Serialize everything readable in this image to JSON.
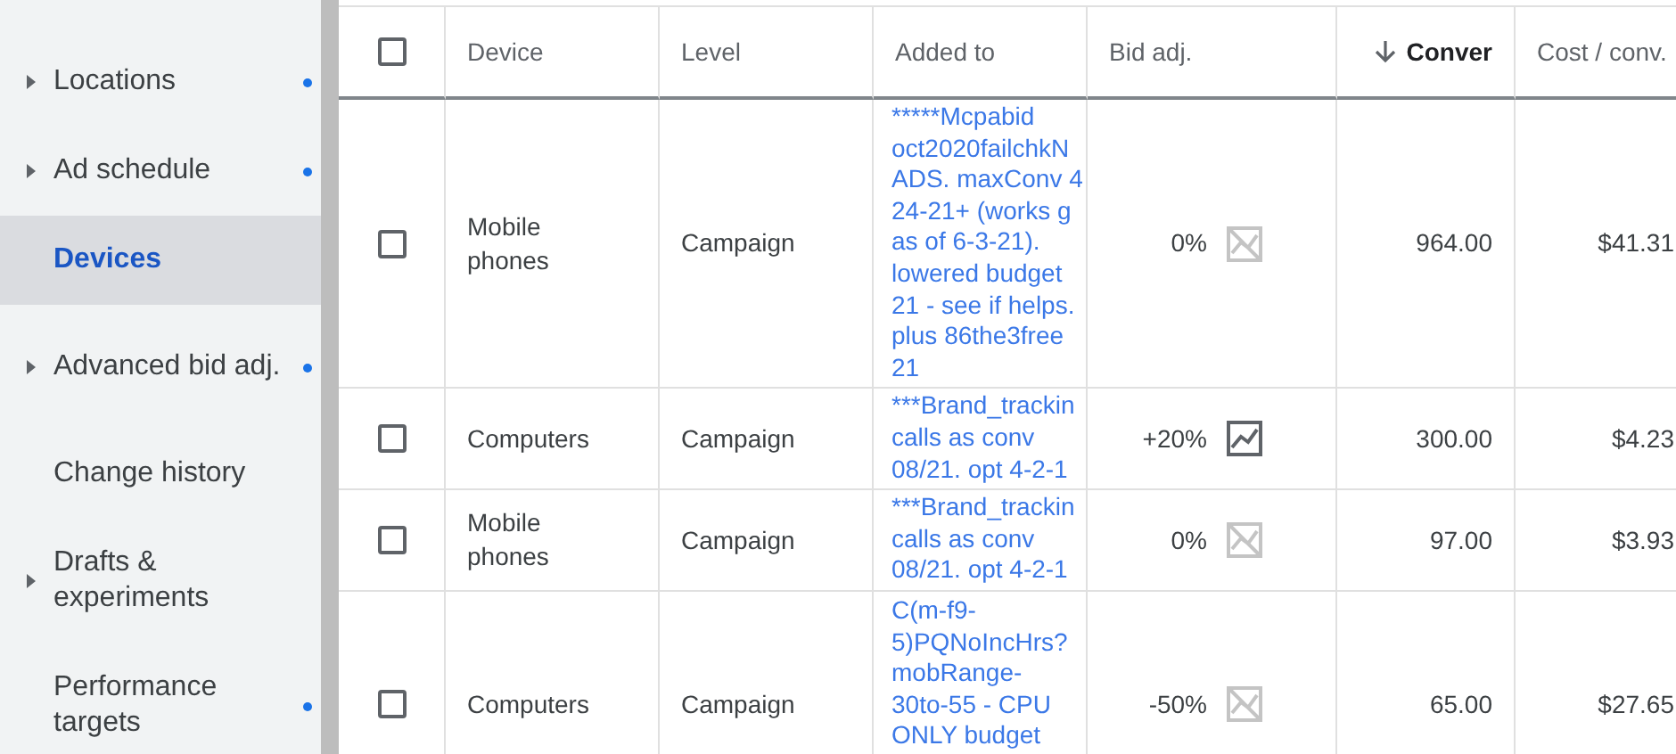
{
  "sidebar": {
    "items": [
      {
        "label": "Locations",
        "expandable": true,
        "dot": true,
        "selected": false
      },
      {
        "label": "Ad schedule",
        "expandable": true,
        "dot": true,
        "selected": false
      },
      {
        "label": "Devices",
        "expandable": false,
        "dot": false,
        "selected": true
      },
      {
        "label": "Advanced bid adj.",
        "expandable": true,
        "dot": true,
        "selected": false
      },
      {
        "label": "Change history",
        "expandable": false,
        "dot": false,
        "selected": false
      },
      {
        "label": "Drafts & experiments",
        "expandable": true,
        "dot": false,
        "selected": false
      },
      {
        "label": "Performance targets",
        "expandable": false,
        "dot": true,
        "selected": false
      }
    ]
  },
  "table": {
    "select_all": {
      "checked": false
    },
    "columns": [
      {
        "label": "Device",
        "sorted": false
      },
      {
        "label": "Level",
        "sorted": false
      },
      {
        "label": "Added to",
        "sorted": false
      },
      {
        "label": "Bid adj.",
        "sorted": false
      },
      {
        "label": "Conver",
        "sorted": true
      },
      {
        "label": "Cost / conv.",
        "sorted": false
      }
    ],
    "rows": [
      {
        "checked": false,
        "device": "Mobile phones",
        "level": "Campaign",
        "added_to": "*****Mcpabid\noct2020failchkN\nADS. maxConv 4\n24-21+ (works g\nas of 6-3-21).\nlowered budget\n21 - see if helps.\nplus 86the3free\n21",
        "bid_adj": "0%",
        "chart_enabled": false,
        "conversions": "964.00",
        "cost_per_conv": "$41.31"
      },
      {
        "checked": false,
        "device": "Computers",
        "level": "Campaign",
        "added_to": "***Brand_trackin\ncalls as conv\n08/21. opt 4-2-1",
        "bid_adj": "+20%",
        "chart_enabled": true,
        "conversions": "300.00",
        "cost_per_conv": "$4.23"
      },
      {
        "checked": false,
        "device": "Mobile phones",
        "level": "Campaign",
        "added_to": "***Brand_trackin\ncalls as conv\n08/21. opt 4-2-1",
        "bid_adj": "0%",
        "chart_enabled": false,
        "conversions": "97.00",
        "cost_per_conv": "$3.93"
      },
      {
        "checked": false,
        "device": "Computers",
        "level": "Campaign",
        "added_to": "C(m-f9-\n5)PQNoIncHrs?\nmobRange-\n30to-55 - CPU\nONLY budget",
        "bid_adj": "-50%",
        "chart_enabled": false,
        "conversions": "65.00",
        "cost_per_conv": "$27.65"
      }
    ]
  }
}
